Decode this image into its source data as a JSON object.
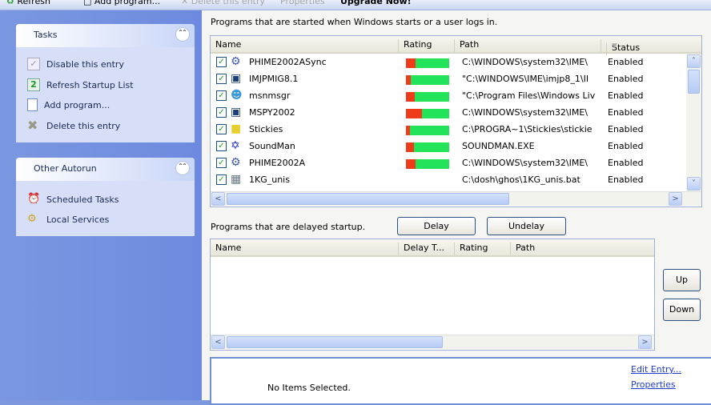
{
  "toolbar": {
    "refresh": "Refresh",
    "add_program": "Add program...",
    "delete_entry": "Delete this entry",
    "properties": "Properties",
    "upgrade": "Upgrade Now!"
  },
  "sidebar": {
    "tasks": {
      "title": "Tasks",
      "items": [
        {
          "label": "Disable this entry",
          "icon": "checkbox-icon"
        },
        {
          "label": "Refresh Startup List",
          "icon": "refresh-icon"
        },
        {
          "label": "Add program...",
          "icon": "document-icon"
        },
        {
          "label": "Delete this entry",
          "icon": "delete-icon"
        }
      ]
    },
    "other": {
      "title": "Other Autorun",
      "items": [
        {
          "label": "Scheduled Tasks",
          "icon": "scheduled-tasks-icon"
        },
        {
          "label": "Local Services",
          "icon": "services-icon"
        }
      ]
    }
  },
  "startup": {
    "caption": "Programs that are started when Windows starts or a user logs in.",
    "columns": [
      "Name",
      "Rating",
      "Path",
      "Status"
    ],
    "rows": [
      {
        "name": "PHIME2002ASync",
        "rating": 0.22,
        "path": "C:\\WINDOWS\\system32\\IME\\",
        "status": "Enabled"
      },
      {
        "name": "IMJPMIG8.1",
        "rating": 0.12,
        "path": "\"C:\\WINDOWS\\IME\\imjp8_1\\II",
        "status": "Enabled"
      },
      {
        "name": "msnmsgr",
        "rating": 0.2,
        "path": "\"C:\\Program Files\\Windows Liv",
        "status": "Enabled"
      },
      {
        "name": "MSPY2002",
        "rating": 0.37,
        "path": "C:\\WINDOWS\\system32\\IME\\",
        "status": "Enabled"
      },
      {
        "name": "Stickies",
        "rating": 0.1,
        "path": "C:\\PROGRA~1\\Stickies\\stickie",
        "status": "Enabled"
      },
      {
        "name": "SoundMan",
        "rating": 0.18,
        "path": "SOUNDMAN.EXE",
        "status": "Enabled"
      },
      {
        "name": "PHIME2002A",
        "rating": 0.22,
        "path": "C:\\WINDOWS\\system32\\IME\\",
        "status": "Enabled"
      },
      {
        "name": "1KG_unis",
        "rating": null,
        "path": "C:\\dosh\\ghos\\1KG_unis.bat",
        "status": "Enabled"
      }
    ]
  },
  "delayed": {
    "caption": "Programs that are delayed startup.",
    "delay": "Delay",
    "undelay": "Undelay",
    "columns": [
      "Name",
      "Delay T...",
      "Rating",
      "Path"
    ],
    "up": "Up",
    "down": "Down"
  },
  "details": {
    "empty": "No Items Selected.",
    "edit": "Edit Entry...",
    "properties": "Properties"
  }
}
